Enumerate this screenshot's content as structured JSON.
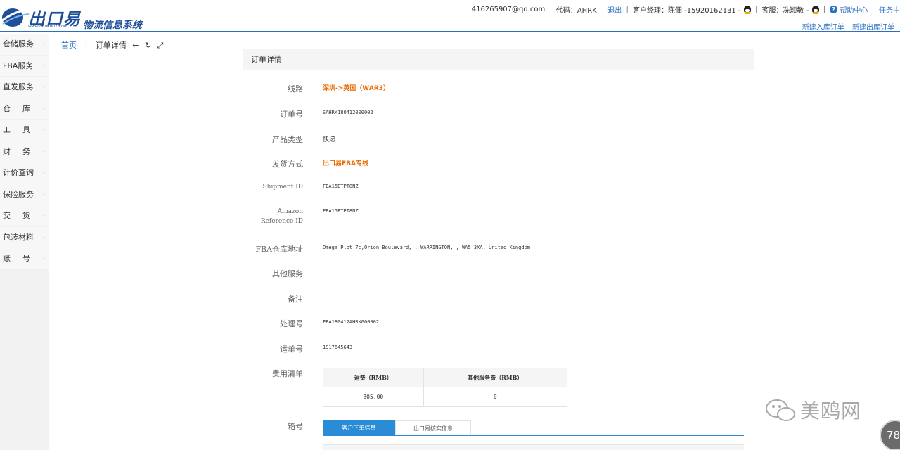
{
  "header": {
    "logo_title": "出口易",
    "logo_url": "www.chukou1.com",
    "logo_subtitle": "物流信息系统",
    "account": "416265907@qq.com",
    "code_label": "代码：AHRK",
    "logout": "退出",
    "manager": "客户经理：陈佃 -15920162131 -",
    "service": "客服：冼颖敏 -",
    "help": "帮助中心",
    "tasks": "任务中",
    "new_inbound": "新建入库订单",
    "new_outbound": "新建出库订单"
  },
  "sidebar": {
    "items": [
      {
        "label": "仓储服务"
      },
      {
        "label": "FBA服务"
      },
      {
        "label": "直发服务"
      },
      {
        "label": "仓库"
      },
      {
        "label": "工具"
      },
      {
        "label": "财务"
      },
      {
        "label": "计价查询"
      },
      {
        "label": "保险服务"
      },
      {
        "label": "交货"
      },
      {
        "label": "包装材料"
      },
      {
        "label": "账号"
      }
    ]
  },
  "breadcrumb": {
    "home": "首页",
    "current": "订单详情"
  },
  "panel": {
    "title": "订单详情",
    "fields": {
      "route_label": "线路",
      "route_value": "深圳->英国（WAR3）",
      "order_no_label": "订单号",
      "order_no_value": "SAHRK180412000002",
      "product_type_label": "产品类型",
      "product_type_value": "快递",
      "shipping_label": "发货方式",
      "shipping_value": "出口易FBA专线",
      "shipment_id_label": "Shipment ID",
      "shipment_id_value": "FBA15BTPT8NZ",
      "amazon_ref_label_1": "Amazon",
      "amazon_ref_label_2": "Reference ID",
      "amazon_ref_value": "FBA15BTPT8NZ",
      "fba_addr_label": "FBA仓库地址",
      "fba_addr_value": "Omega Plot 7c,Orion Boulevard, , WARRINGTON, , WA5 3XA, United Kingdom",
      "other_service_label": "其他服务",
      "remark_label": "备注",
      "process_no_label": "处理号",
      "process_no_value": "FBA180412AHRK000002",
      "tracking_label": "运单号",
      "tracking_value": "1917645643",
      "fee_label": "费用清单",
      "box_label": "箱号"
    },
    "fee_table": {
      "headers": [
        "运费（RMB）",
        "其他服务费（RMB）"
      ],
      "row": [
        "805.00",
        "0"
      ]
    },
    "tabs": {
      "active": "客户下单信息",
      "inactive": "出口易核实信息"
    }
  },
  "watermark": {
    "text": "美鸥网",
    "badge": "78"
  },
  "colors": {
    "accent": "#2a6fc2",
    "orange": "#e86a00",
    "tab_active": "#2a8bd6"
  }
}
